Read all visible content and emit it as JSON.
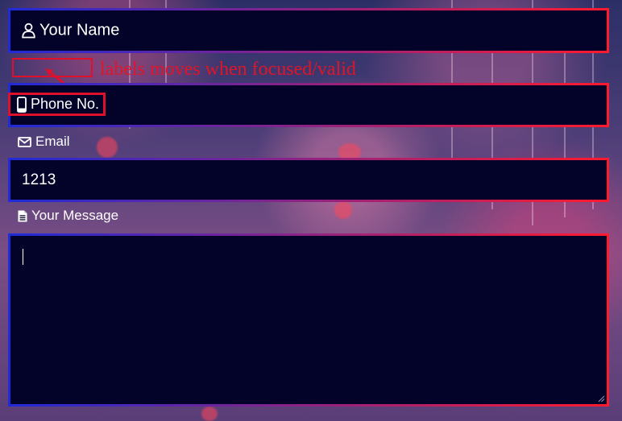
{
  "form": {
    "name": {
      "label": "Your Name",
      "icon": "user-icon",
      "value": ""
    },
    "phone": {
      "label": "Phone No.",
      "icon": "mobile-phone-icon",
      "value": ""
    },
    "email": {
      "label": "Email",
      "icon": "envelope-icon",
      "value": "1213"
    },
    "message": {
      "label": "Your Message",
      "icon": "document-icon",
      "value": ""
    }
  },
  "annotation": {
    "text": "labels moves when focused/valid",
    "color": "#e01528"
  },
  "colors": {
    "field_background": "#03032a",
    "border_gradient_start": "#1f2bd8",
    "border_gradient_end": "#ff1a2e"
  }
}
